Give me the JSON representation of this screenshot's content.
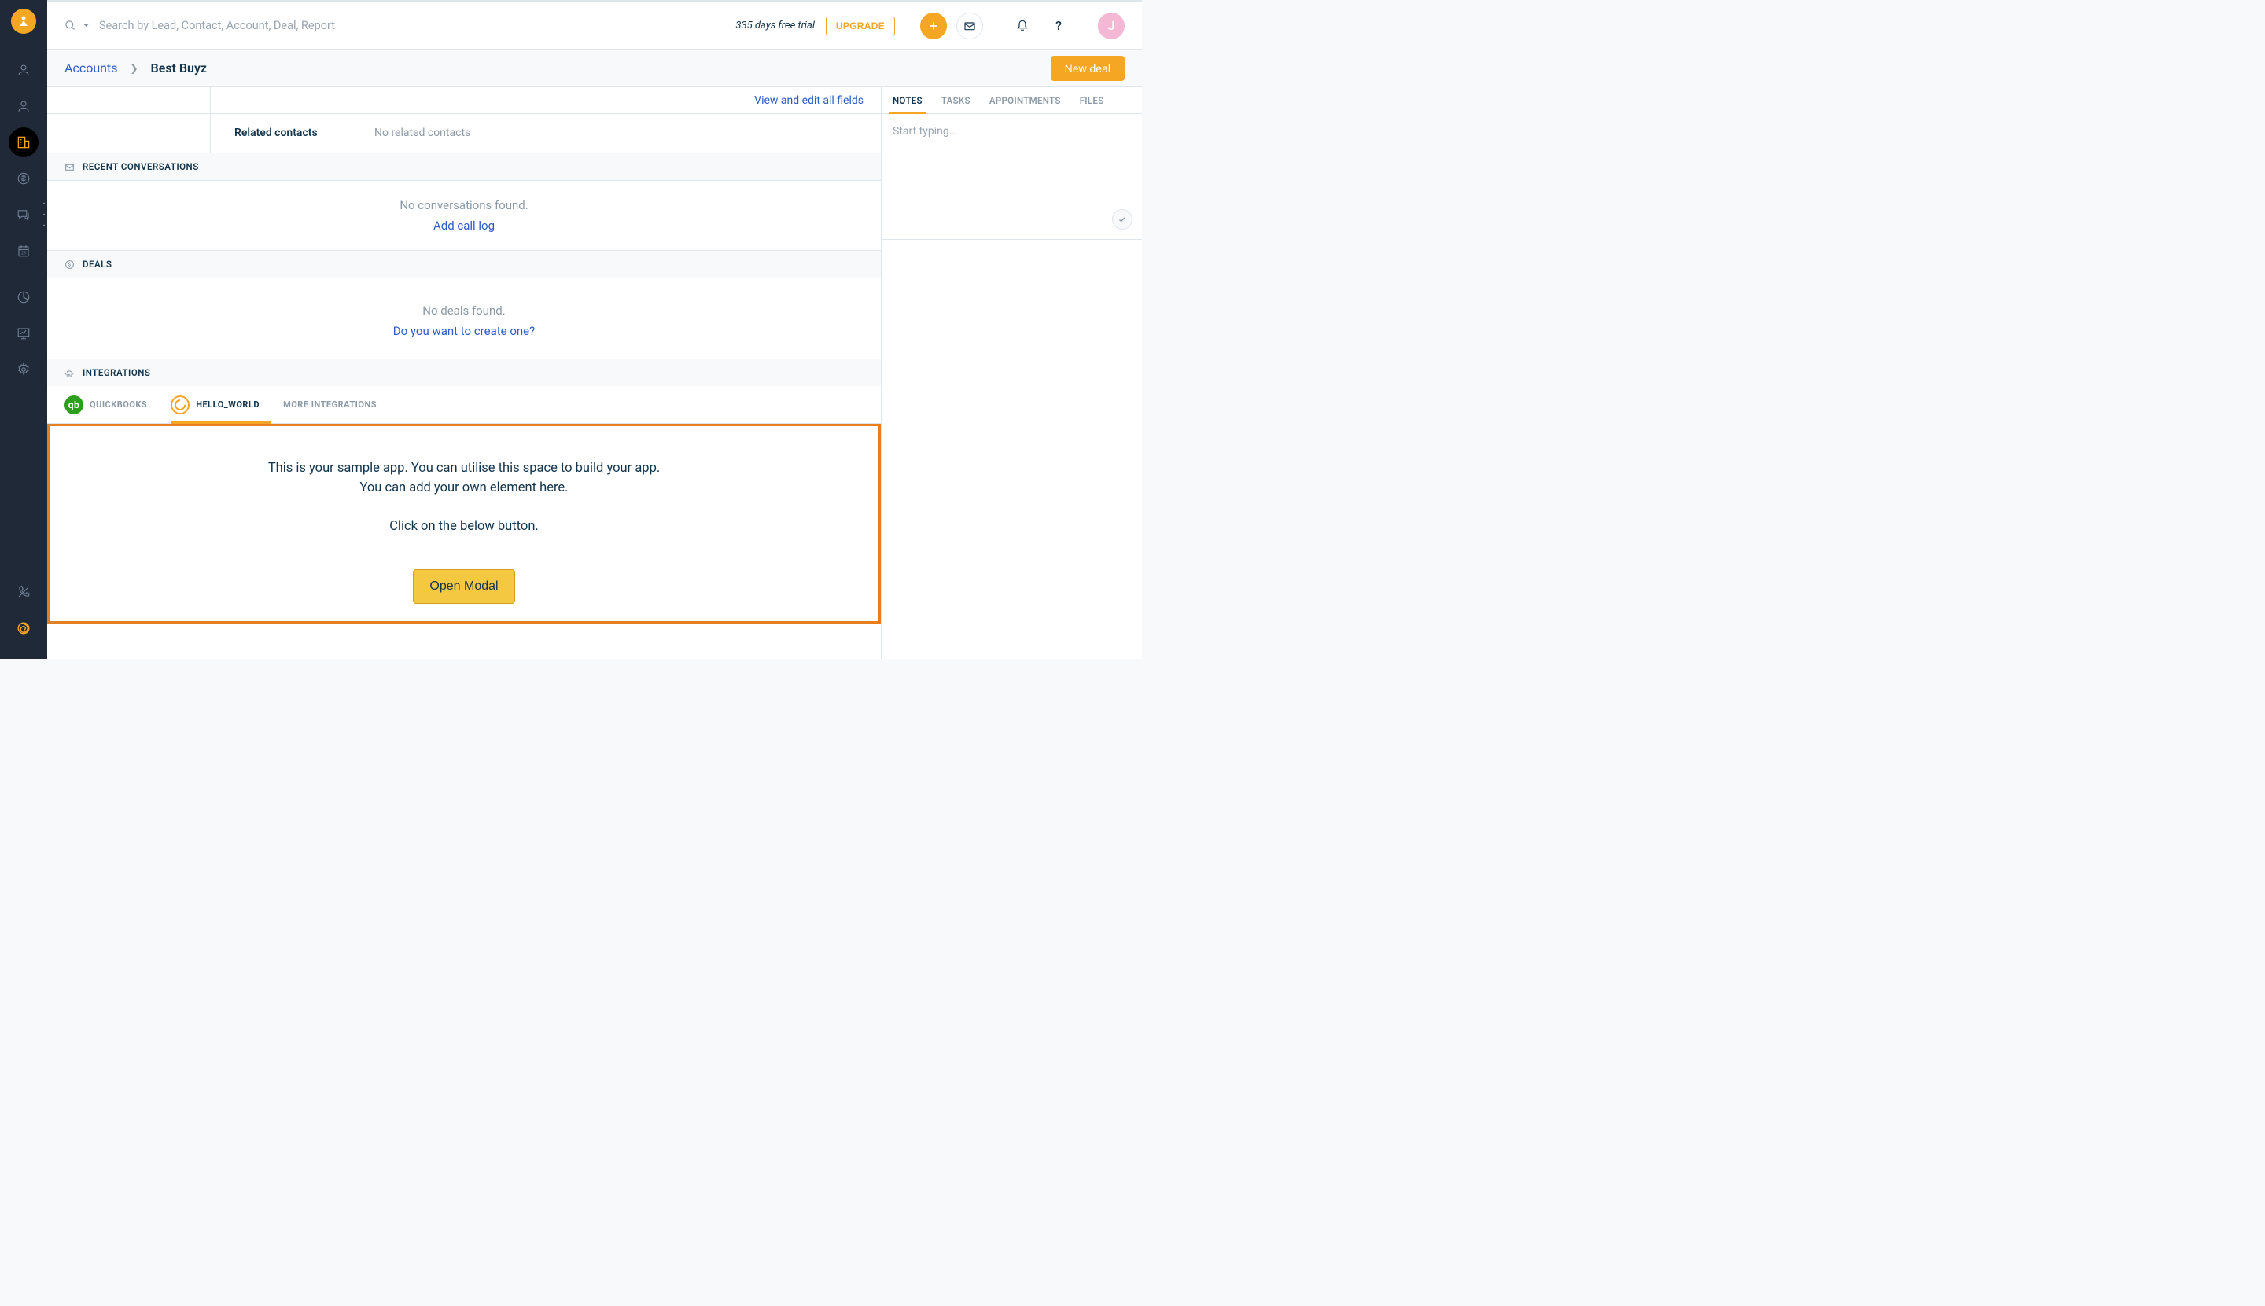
{
  "header": {
    "search_placeholder": "Search by Lead, Contact, Account, Deal, Report",
    "trial_text": "335 days free trial",
    "upgrade_label": "UPGRADE",
    "avatar_initial": "J"
  },
  "breadcrumb": {
    "parent": "Accounts",
    "current": "Best Buyz",
    "new_deal_label": "New deal"
  },
  "details": {
    "view_all_fields": "View and edit all fields",
    "related_contacts_label": "Related contacts",
    "related_contacts_value": "No related contacts"
  },
  "conversations": {
    "heading": "RECENT CONVERSATIONS",
    "empty": "No conversations found.",
    "action": "Add call log"
  },
  "deals": {
    "heading": "DEALS",
    "empty": "No deals found.",
    "action": "Do you want to create one?"
  },
  "integrations": {
    "heading": "INTEGRATIONS",
    "tabs": {
      "quickbooks": "QUICKBOOKS",
      "hello_world": "HELLO_WORLD",
      "more": "MORE INTEGRATIONS"
    },
    "app": {
      "line1": "This is your sample app. You can utilise this space to build your app.",
      "line2": "You can add your own element here.",
      "line3": "Click on the below button.",
      "button": "Open Modal"
    }
  },
  "right": {
    "tabs": {
      "notes": "NOTES",
      "tasks": "TASKS",
      "appointments": "APPOINTMENTS",
      "files": "FILES"
    },
    "notes_placeholder": "Start typing..."
  }
}
